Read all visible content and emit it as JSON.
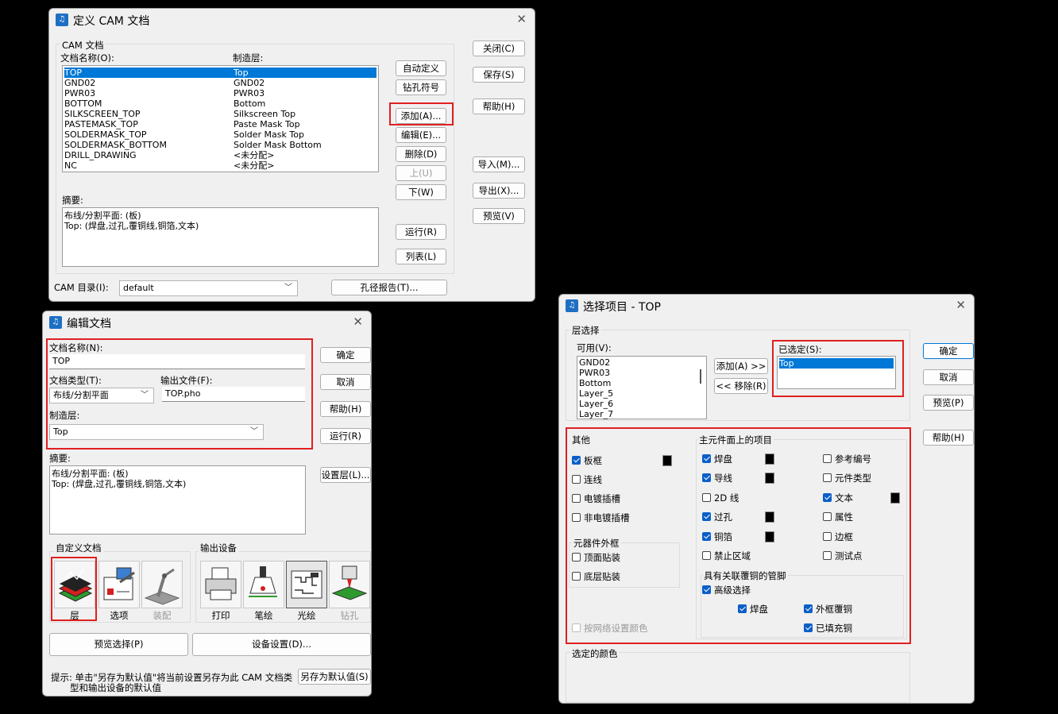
{
  "w1": {
    "title": "定义 CAM 文档",
    "group_label": "CAM 文档",
    "col_name": "文档名称(O):",
    "col_layer": "制造层:",
    "docs": [
      {
        "name": "TOP",
        "layer": "Top"
      },
      {
        "name": "GND02",
        "layer": "GND02"
      },
      {
        "name": "PWR03",
        "layer": "PWR03"
      },
      {
        "name": "BOTTOM",
        "layer": "Bottom"
      },
      {
        "name": "SILKSCREEN_TOP",
        "layer": "Silkscreen Top"
      },
      {
        "name": "PASTEMASK_TOP",
        "layer": "Paste Mask Top"
      },
      {
        "name": "SOLDERMASK_TOP",
        "layer": "Solder Mask Top"
      },
      {
        "name": "SOLDERMASK_BOTTOM",
        "layer": "Solder Mask Bottom"
      },
      {
        "name": "DRILL_DRAWING",
        "layer": "<未分配>"
      },
      {
        "name": "NC",
        "layer": "<未分配>"
      }
    ],
    "summary_label": "摘要:",
    "summary_line1": "布线/分割平面: (板)",
    "summary_line2": "Top: (焊盘,过孔,覆铜线,铜箔,文本)",
    "btn_custom": "自动定义",
    "btn_drill": "钻孔符号",
    "btn_add": "添加(A)...",
    "btn_edit": "编辑(E)...",
    "btn_delete": "删除(D)",
    "btn_up": "上(U)",
    "btn_down": "下(W)",
    "btn_run": "运行(R)",
    "btn_list": "列表(L)",
    "btn_close": "关闭(C)",
    "btn_save": "保存(S)",
    "btn_help": "帮助(H)",
    "btn_import": "导入(M)...",
    "btn_export": "导出(X)...",
    "btn_preview": "预览(V)",
    "cam_dir_label": "CAM 目录(I):",
    "cam_dir_value": "default",
    "btn_hole_report": "孔径报告(T)..."
  },
  "w2": {
    "title": "编辑文档",
    "doc_name_label": "文档名称(N):",
    "doc_name_value": "TOP",
    "doc_type_label": "文档类型(T):",
    "doc_type_value": "布线/分割平面",
    "out_file_label": "输出文件(F):",
    "out_file_value": "TOP.pho",
    "layer_label": "制造层:",
    "layer_value": "Top",
    "summary_label": "摘要:",
    "summary_line1": "布线/分割平面: (板)",
    "summary_line2": "Top: (焊盘,过孔,覆铜线,铜箔,文本)",
    "btn_ok": "确定",
    "btn_cancel": "取消",
    "btn_help": "帮助(H)",
    "btn_run": "运行(R)",
    "btn_setlayer": "设置层(L)...",
    "custom_label": "自定义文档",
    "output_label": "输出设备",
    "tool_layer": "层",
    "tool_options": "选项",
    "tool_assembly": "装配",
    "tool_print": "打印",
    "tool_pen": "笔绘",
    "tool_photo": "光绘",
    "tool_drill": "钻孔",
    "btn_preview_sel": "预览选择(P)",
    "btn_device": "设备设置(D)...",
    "hint_line1": "提示: 单击\"另存为默认值\"将当前设置另存为此 CAM 文档类",
    "hint_line2": "型和输出设备的默认值",
    "btn_save_default": "另存为默认值(S)"
  },
  "w3": {
    "title": "选择项目 - TOP",
    "layer_sel_label": "层选择",
    "avail_label": "可用(V):",
    "avail_items": [
      "GND02",
      "PWR03",
      "Bottom",
      "Layer_5",
      "Layer_6",
      "Layer_7"
    ],
    "btn_add": "添加(A) >>",
    "btn_remove": "<< 移除(R)",
    "selected_label": "已选定(S):",
    "selected_items": [
      "Top"
    ],
    "btn_ok": "确定",
    "btn_cancel": "取消",
    "btn_preview": "预览(P)",
    "btn_help": "帮助(H)",
    "other_label": "其他",
    "cb_board": "板框",
    "cb_connection": "连线",
    "cb_plated_slot": "电镀插槽",
    "cb_nonplated_slot": "非电镀插槽",
    "outline_label": "元器件外框",
    "cb_top_mount": "顶面贴装",
    "cb_bottom_mount": "底层贴装",
    "cb_net_color": "按网络设置颜色",
    "main_label": "主元件面上的项目",
    "cb_pad": "焊盘",
    "cb_trace": "导线",
    "cb_2d": "2D 线",
    "cb_via": "过孔",
    "cb_copper": "铜箔",
    "cb_keepout": "禁止区域",
    "cb_refdes": "参考编号",
    "cb_parttype": "元件类型",
    "cb_text": "文本",
    "cb_attr": "属性",
    "cb_outline": "边框",
    "cb_testpoint": "测试点",
    "pour_label": "具有关联覆铜的管脚",
    "cb_adv_select": "高级选择",
    "cb_pour_pad": "焊盘",
    "cb_outline_pour": "外框覆铜",
    "cb_filled_copper": "已填充铜",
    "sel_color_label": "选定的颜色"
  }
}
